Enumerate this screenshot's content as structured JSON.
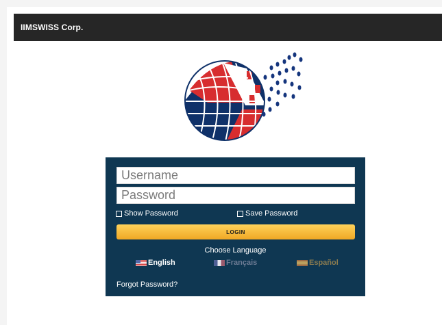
{
  "app_bar": {
    "title": "IIMSWISS Corp."
  },
  "logo": {
    "name": "iimswiss-globe-logo-icon"
  },
  "login_form": {
    "username_placeholder": "Username",
    "password_placeholder": "Password",
    "show_password_label": "Show Password",
    "save_password_label": "Save Password",
    "login_label": "LOGIN",
    "choose_language_label": "Choose Language",
    "languages": [
      {
        "label": "English",
        "flag": "us-flag-icon",
        "selected": true
      },
      {
        "label": "Français",
        "flag": "france-flag-icon",
        "selected": false
      },
      {
        "label": "Español",
        "flag": "spain-flag-icon",
        "selected": false
      }
    ],
    "forgot_password_label": "Forgot Password?"
  },
  "colors": {
    "app_bar": "#262626",
    "panel": "#0f3752",
    "login_button": "#f4b634",
    "english_text": "#ffffff",
    "inactive_language_text": "#6e7c95"
  }
}
